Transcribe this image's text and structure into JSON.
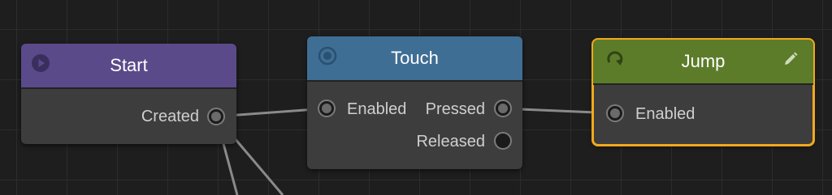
{
  "nodes": {
    "start": {
      "title": "Start",
      "icon": "play-circle-icon",
      "color": "#5b4a8a",
      "outputs": [
        "Created"
      ]
    },
    "touch": {
      "title": "Touch",
      "icon": "radio-target-icon",
      "color": "#3f6e95",
      "inputs": [
        "Enabled"
      ],
      "outputs": [
        "Pressed",
        "Released"
      ]
    },
    "jump": {
      "title": "Jump",
      "icon": "rotate-arrow-icon",
      "edit_icon": "pencil-icon",
      "color": "#5c7c2a",
      "selected": true,
      "selection_color": "#f2a91c",
      "inputs": [
        "Enabled"
      ]
    }
  },
  "connections": [
    {
      "from": "Start.Created",
      "to": "Touch.Enabled"
    },
    {
      "from": "Touch.Pressed",
      "to": "Jump.Enabled"
    }
  ]
}
